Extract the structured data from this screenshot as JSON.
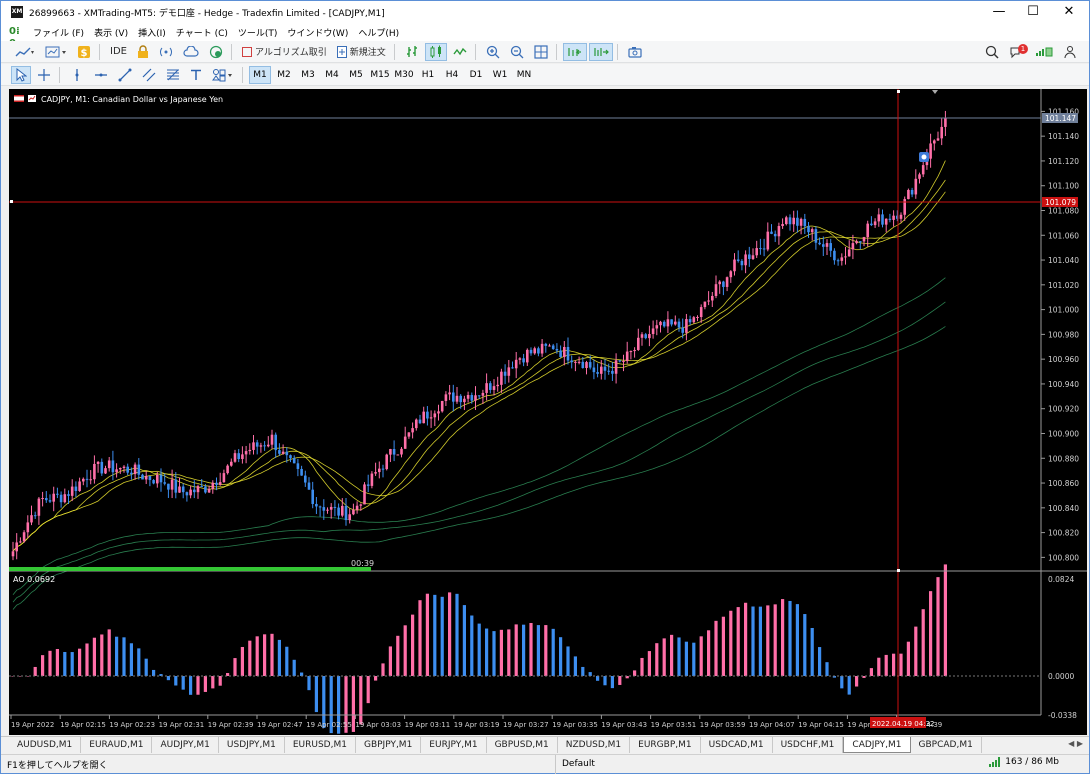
{
  "window": {
    "icon_text": "XM",
    "title": "26899663 - XMTrading-MT5: デモ口座 - Hedge - Tradexfin Limited - [CADJPY,M1]",
    "minimize": "—",
    "maximize": "☐",
    "close": "✕"
  },
  "menu": {
    "logo": "0⁞0",
    "items": [
      "ファイル (F)",
      "表示 (V)",
      "挿入(I)",
      "チャート (C)",
      "ツール(T)",
      "ウインドウ(W)",
      "ヘルプ(H)"
    ]
  },
  "toolbar1": {
    "ide": "IDE",
    "algo": "アルゴリズム取引",
    "new_order": "新規注文",
    "notify_count": "1"
  },
  "toolbar2": {
    "timeframes": [
      "M1",
      "M2",
      "M3",
      "M4",
      "M5",
      "M15",
      "M30",
      "H1",
      "H4",
      "D1",
      "W1",
      "MN"
    ],
    "active_timeframe": "M1"
  },
  "chart": {
    "symbol_header": "CADJPY, M1:  Canadian Dollar vs Japanese Yen",
    "bid_label": "101.147",
    "crosshair_price_label": "101.079",
    "crosshair_time_label": "2022.04.19 04:32",
    "countdown": "00:39",
    "price_ticks": [
      "101.160",
      "101.140",
      "101.120",
      "101.100",
      "101.080",
      "101.060",
      "101.040",
      "101.020",
      "101.000",
      "100.980",
      "100.960",
      "100.940",
      "100.920",
      "100.900",
      "100.880",
      "100.860",
      "100.840",
      "100.820",
      "100.800"
    ],
    "time_ticks": [
      "19 Apr 2022",
      "19 Apr 02:15",
      "19 Apr 02:23",
      "19 Apr 02:31",
      "19 Apr 02:39",
      "19 Apr 02:47",
      "19 Apr 02:55",
      "19 Apr 03:03",
      "19 Apr 03:11",
      "19 Apr 03:19",
      "19 Apr 03:27",
      "19 Apr 03:35",
      "19 Apr 03:43",
      "19 Apr 03:51",
      "19 Apr 03:59",
      "19 Apr 04:07",
      "19 Apr 04:15",
      "19 Apr 04:",
      "19 Apr 04:39"
    ],
    "colors": {
      "background": "#000000",
      "bull": "#ff6fa8",
      "bear": "#3d8ef0",
      "ma_fast": "#e8e030",
      "ma_slow": "#2e8b57",
      "crosshair": "#cc1111",
      "progress": "#34c634"
    }
  },
  "ao": {
    "label": "AO 0.0692",
    "ticks": [
      "0.0824",
      "0.0000",
      "-0.0338"
    ]
  },
  "chart_data": {
    "type": "candlestick",
    "title": "CADJPY, M1:  Canadian Dollar vs Japanese Yen",
    "ylim": [
      100.789,
      101.17
    ],
    "ao_ylim": [
      -0.0338,
      0.0824
    ],
    "close_keypoints": [
      [
        0,
        100.805
      ],
      [
        8,
        100.845
      ],
      [
        20,
        100.865
      ],
      [
        32,
        100.875
      ],
      [
        45,
        100.85
      ],
      [
        58,
        100.87
      ],
      [
        70,
        100.9
      ],
      [
        82,
        100.84
      ],
      [
        92,
        100.84
      ],
      [
        100,
        100.872
      ],
      [
        110,
        100.915
      ],
      [
        122,
        100.93
      ],
      [
        134,
        100.952
      ],
      [
        146,
        100.975
      ],
      [
        158,
        100.945
      ],
      [
        170,
        100.975
      ],
      [
        182,
        100.99
      ],
      [
        192,
        101.02
      ],
      [
        200,
        101.05
      ],
      [
        208,
        101.072
      ],
      [
        216,
        101.06
      ],
      [
        224,
        101.045
      ],
      [
        232,
        101.065
      ],
      [
        240,
        101.085
      ],
      [
        248,
        101.128
      ],
      [
        252,
        101.147
      ]
    ]
  }
}
